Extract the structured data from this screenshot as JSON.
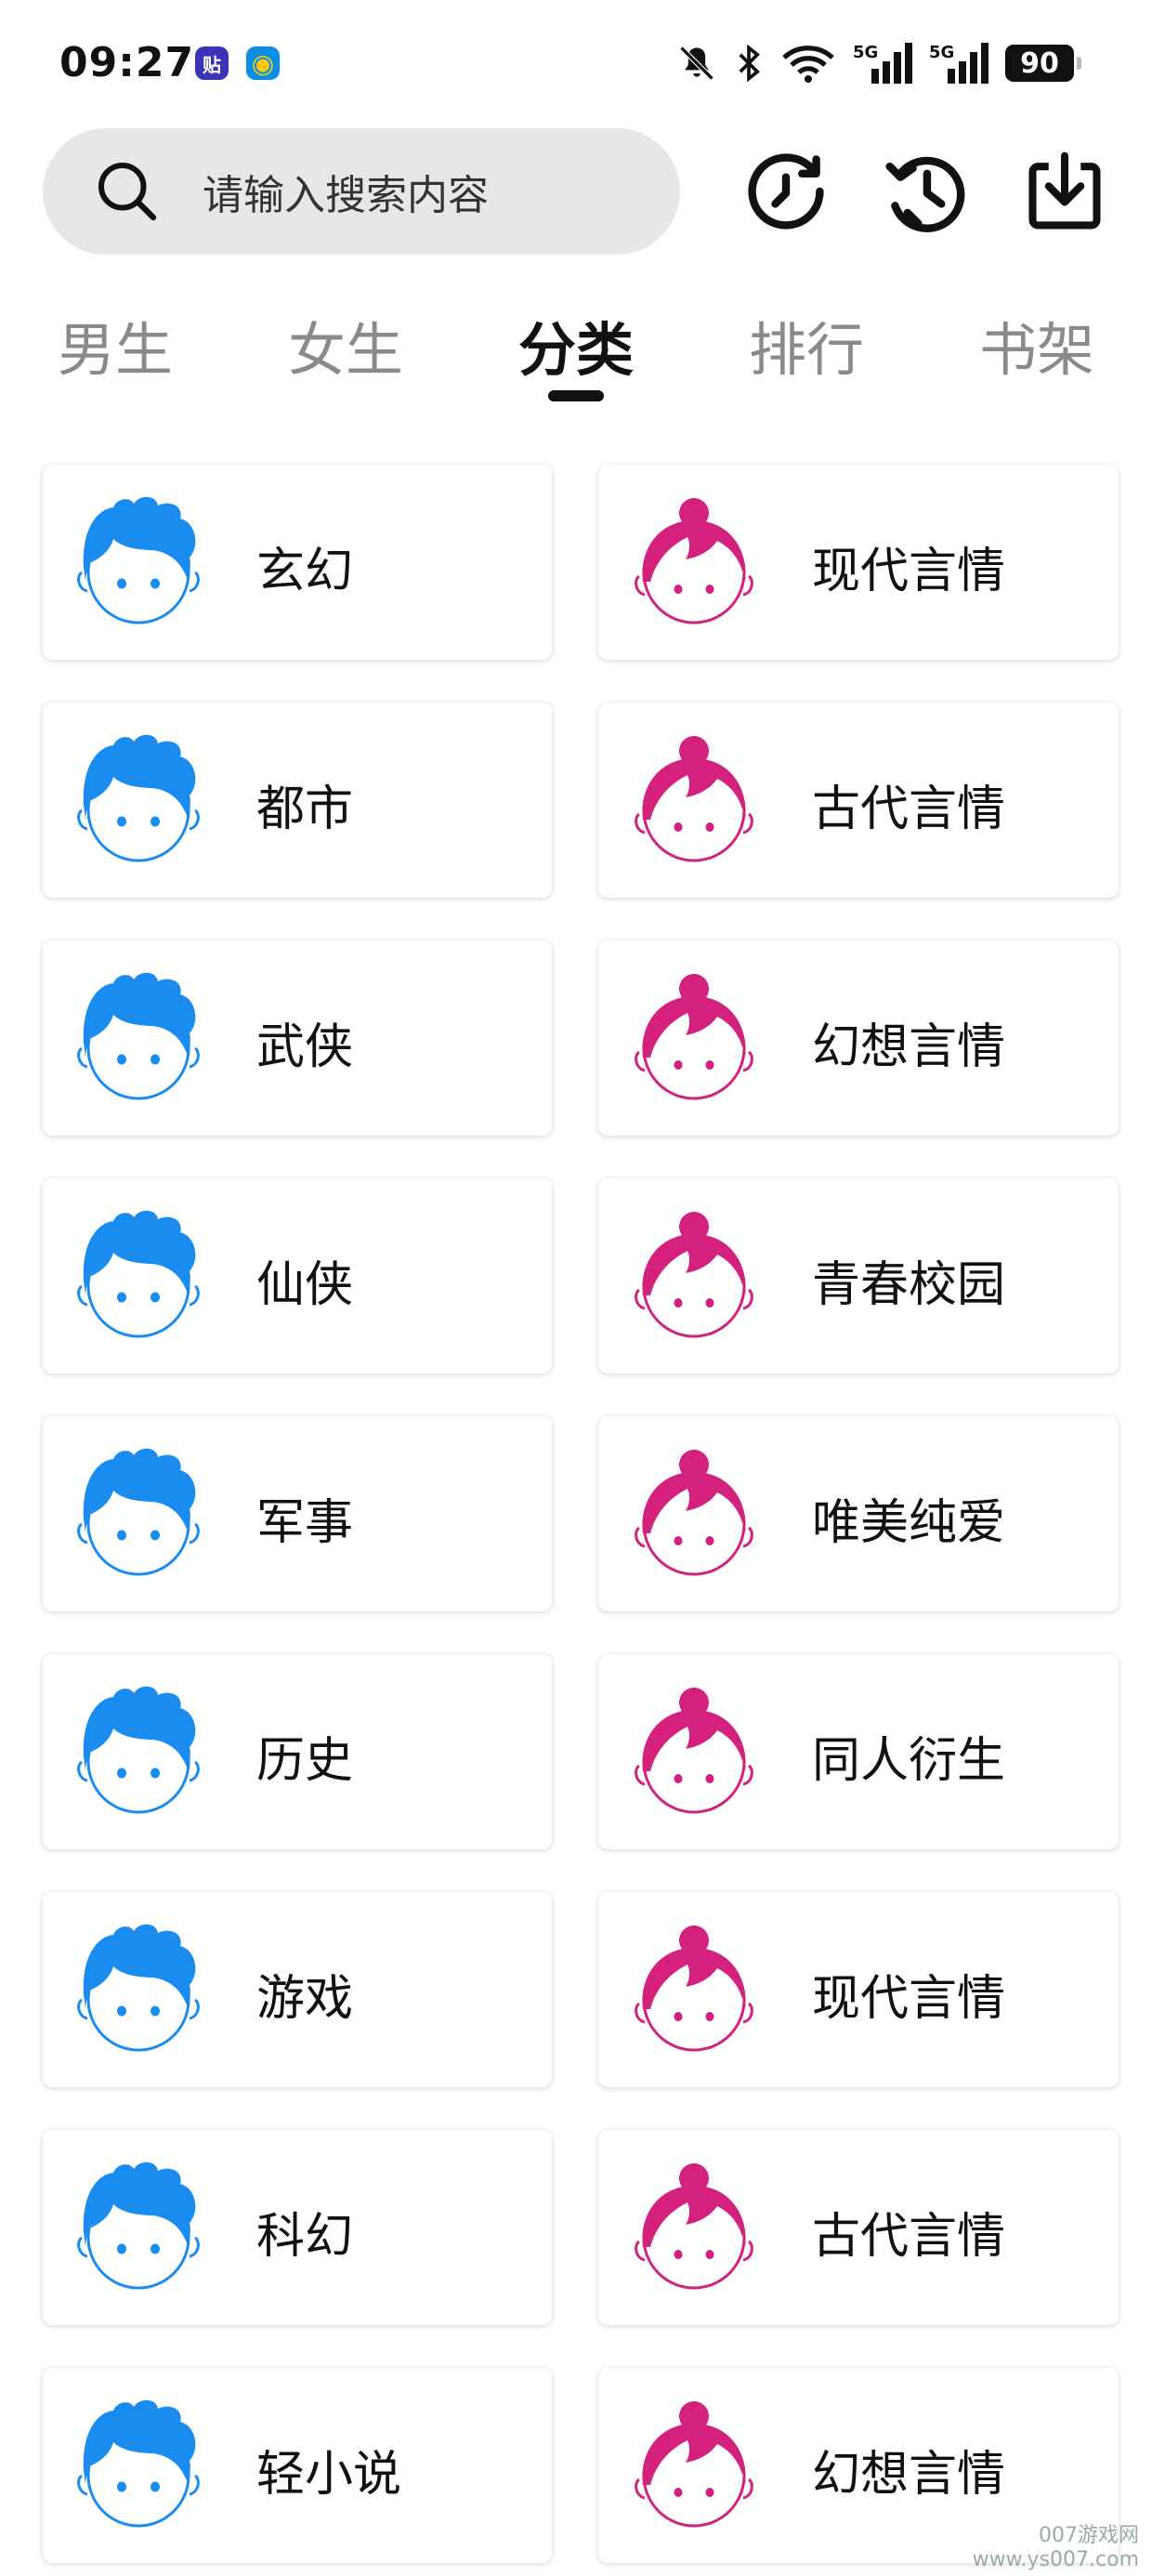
{
  "status_bar": {
    "time": "09:27",
    "badge_tieba": "贴",
    "badge_qq": "◉",
    "signal1": "5G",
    "signal2": "5G",
    "battery": "90"
  },
  "search": {
    "placeholder": "请输入搜索内容"
  },
  "tabs": [
    {
      "label": "男生"
    },
    {
      "label": "女生"
    },
    {
      "label": "分类"
    },
    {
      "label": "排行"
    },
    {
      "label": "书架"
    }
  ],
  "active_tab": "分类",
  "colors": {
    "boy_icon": "#1a8cf0",
    "girl_icon": "#d3217d"
  },
  "categories": {
    "boys": [
      {
        "label": "玄幻"
      },
      {
        "label": "都市"
      },
      {
        "label": "武侠"
      },
      {
        "label": "仙侠"
      },
      {
        "label": "军事"
      },
      {
        "label": "历史"
      },
      {
        "label": "游戏"
      },
      {
        "label": "科幻"
      },
      {
        "label": "轻小说"
      }
    ],
    "girls": [
      {
        "label": "现代言情"
      },
      {
        "label": "古代言情"
      },
      {
        "label": "幻想言情"
      },
      {
        "label": "青春校园"
      },
      {
        "label": "唯美纯爱"
      },
      {
        "label": "同人衍生"
      },
      {
        "label": "现代言情"
      },
      {
        "label": "古代言情"
      },
      {
        "label": "幻想言情"
      }
    ]
  },
  "watermark": {
    "line1": "007游戏网",
    "line2": "www.ys007.com"
  }
}
